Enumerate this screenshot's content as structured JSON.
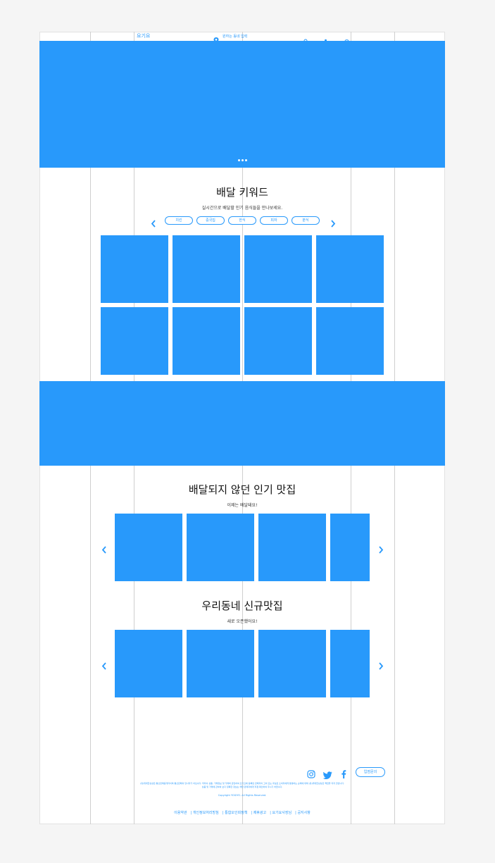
{
  "header": {
    "logo": "요기요",
    "location": "원하는 동네 입력",
    "dropdown_icon": "chevron-down-icon",
    "search_icon": "search-icon",
    "user_icon": "user-icon",
    "support_icon": "headset-icon"
  },
  "keyword_section": {
    "title": "배달 키워드",
    "subtitle": "실시간으로 배달할 인기 음식들을 만나보세요.",
    "pills": [
      "치킨",
      "중국집",
      "한식",
      "피자",
      "분식"
    ]
  },
  "popular_section": {
    "title": "배달되지 않던 인기 맛집",
    "subtitle": "이제는 배달돼요!"
  },
  "new_section": {
    "title": "우리동네 신규맛집",
    "subtitle": "새로 오픈했어요!"
  },
  "footer": {
    "contact_button": "입점문의",
    "social_icons": [
      "instagram-icon",
      "twitter-icon",
      "facebook-icon"
    ],
    "notice_line1": "(유)위대한상상은 통신판매중개자이며 통신판매의 당사자가 아닙니다. 따라서 상품, 거래정보 및 거래와 관련하여 요기요에 등록된 판매자의 고의 또는 과실로 소비자에게 발생하는 손해에 대해 (유)위대한상상은 책임을 지지 않습니다.",
    "notice_line2": "상품 및 거래에 관하여 보다 정확한 정보는 해당 판매자에게 직접 확인하여 주시기 바랍니다.",
    "copyright": "Copyright YOGIYO. All Rights Reserved.",
    "links": [
      "이용약관",
      "개인정보처리방침",
      "통합오인회정책",
      "제휴광고",
      "요기요사장님",
      "공지사항"
    ]
  },
  "colors": {
    "accent": "#2899fb",
    "guide": "#cfcfcf",
    "background": "#f5f5f5"
  }
}
